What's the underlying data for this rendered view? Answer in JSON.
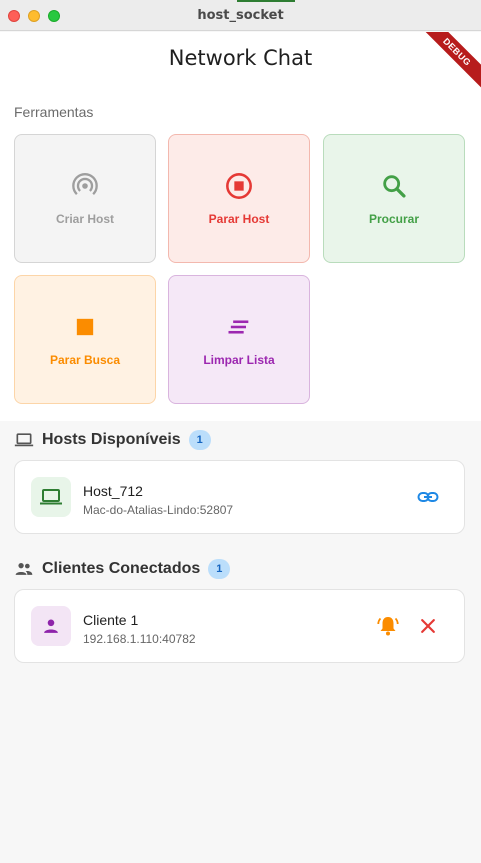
{
  "window": {
    "title": "host_socket"
  },
  "header": {
    "title": "Network Chat",
    "debug_banner": "DEBUG"
  },
  "tools": {
    "label": "Ferramentas",
    "items": [
      {
        "label": "Criar Host",
        "icon": "wifi-tethering-icon",
        "color": "#9e9e9e",
        "enabled": false
      },
      {
        "label": "Parar Host",
        "icon": "stop-circle-icon",
        "color": "#e53935"
      },
      {
        "label": "Procurar",
        "icon": "search-icon",
        "color": "#43a047"
      },
      {
        "label": "Parar Busca",
        "icon": "stop-icon",
        "color": "#fb8c00"
      },
      {
        "label": "Limpar Lista",
        "icon": "clear-all-icon",
        "color": "#9c27b0"
      }
    ]
  },
  "hosts": {
    "title": "Hosts Disponíveis",
    "count": "1",
    "items": [
      {
        "name": "Host_712",
        "address": "Mac-do-Atalias-Lindo:52807",
        "icon": "laptop-icon",
        "action": "link-icon"
      }
    ]
  },
  "clients": {
    "title": "Clientes Conectados",
    "count": "1",
    "items": [
      {
        "name": "Cliente 1",
        "address": "192.168.1.110:40782",
        "icon": "person-icon",
        "actions": [
          "bell-ring-icon",
          "close-icon"
        ]
      }
    ]
  },
  "colors": {
    "accent_blue": "#1e88e5",
    "host_green": "#2e7d32",
    "client_purple": "#8e24aa",
    "bell_orange": "#fb8c00",
    "close_red": "#e53935"
  }
}
